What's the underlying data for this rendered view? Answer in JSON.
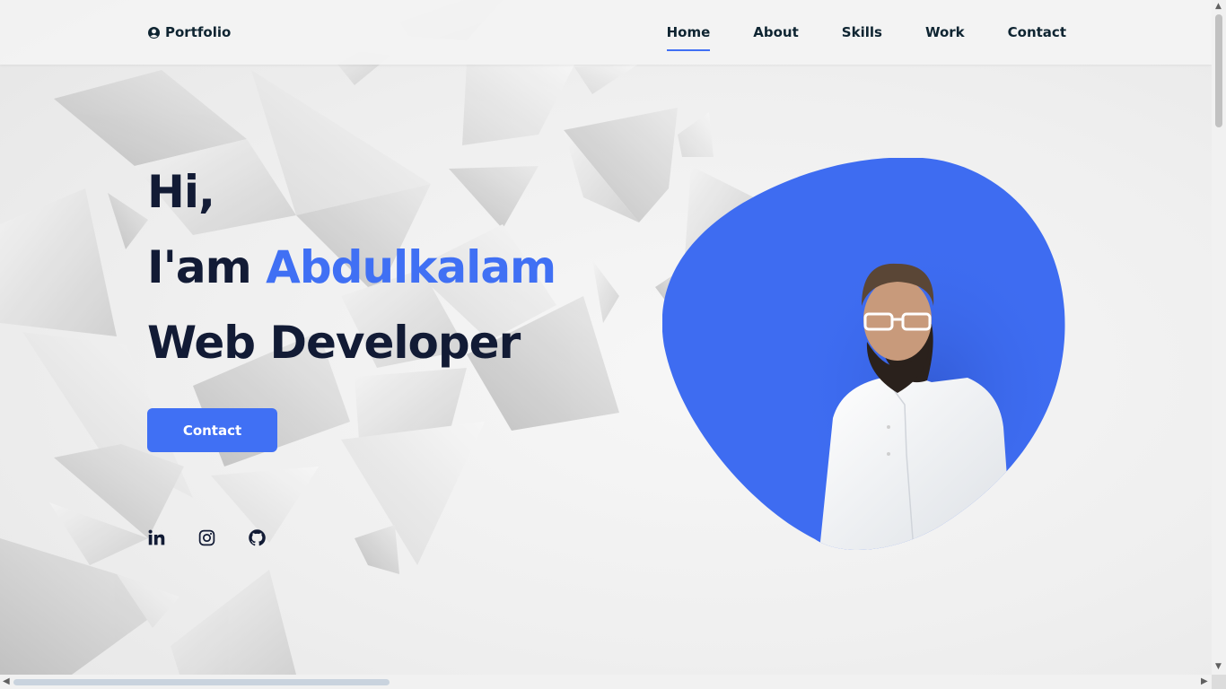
{
  "header": {
    "logo_label": "Portfolio",
    "nav": [
      {
        "label": "Home",
        "active": true
      },
      {
        "label": "About",
        "active": false
      },
      {
        "label": "Skills",
        "active": false
      },
      {
        "label": "Work",
        "active": false
      },
      {
        "label": "Contact",
        "active": false
      }
    ]
  },
  "hero": {
    "greeting": "Hi,",
    "intro_prefix": "I'am ",
    "name": "Abdulkalam",
    "role": "Web Developer",
    "contact_button": "Contact"
  },
  "socials": [
    {
      "icon": "linkedin-icon"
    },
    {
      "icon": "instagram-icon"
    },
    {
      "icon": "github-icon"
    }
  ],
  "colors": {
    "accent": "#4070f4",
    "heading": "#121b35",
    "background": "#efefef"
  }
}
